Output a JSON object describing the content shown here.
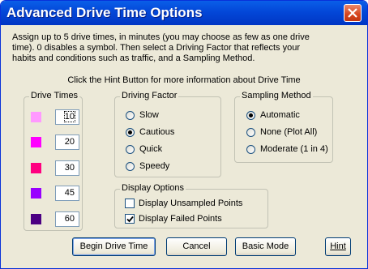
{
  "window": {
    "title": "Advanced Drive Time Options"
  },
  "instructions": {
    "line1": "Assign up to 5 drive times, in minutes (you may choose as few as one drive",
    "line2": "time).  0 disables a symbol.  Then select a Driving Factor that reflects your",
    "line3": "habits and conditions such as traffic, and a Sampling Method.",
    "hint_line": "Click the Hint Button for more information about Drive Time"
  },
  "drive_times": {
    "legend": "Drive Times",
    "rows": [
      {
        "color": "#ff99ff",
        "value": "10"
      },
      {
        "color": "#ff00ff",
        "value": "20"
      },
      {
        "color": "#ff0080",
        "value": "30"
      },
      {
        "color": "#9900ff",
        "value": "45"
      },
      {
        "color": "#4b0082",
        "value": "60"
      }
    ]
  },
  "driving_factor": {
    "legend": "Driving Factor",
    "options": [
      "Slow",
      "Cautious",
      "Quick",
      "Speedy"
    ],
    "selected": "Cautious"
  },
  "sampling_method": {
    "legend": "Sampling Method",
    "options": [
      "Automatic",
      "None (Plot All)",
      "Moderate (1 in 4)"
    ],
    "selected": "Automatic"
  },
  "display_options": {
    "legend": "Display Options",
    "unsampled_label": "Display Unsampled Points",
    "unsampled_checked": false,
    "failed_label": "Display Failed Points",
    "failed_checked": true
  },
  "buttons": {
    "begin": "Begin Drive Time",
    "cancel": "Cancel",
    "basic": "Basic Mode",
    "hint": "Hint"
  }
}
